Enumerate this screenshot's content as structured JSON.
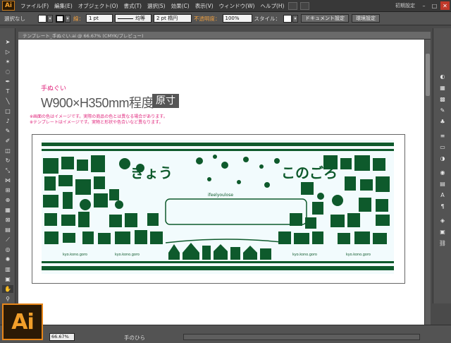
{
  "app": {
    "logo": "Ai"
  },
  "menu": [
    "ファイル(F)",
    "編集(E)",
    "オブジェクト(O)",
    "書式(T)",
    "選択(S)",
    "効果(C)",
    "表示(V)",
    "ウィンドウ(W)",
    "ヘルプ(H)"
  ],
  "workspace": "初期設定",
  "control": {
    "selection": "選択なし",
    "stroke_label": "線：",
    "stroke_weight": "1 pt",
    "stroke_style": "均等",
    "brush": "2 pt 楕円",
    "opacity_label": "不透明度：",
    "opacity": "100%",
    "style_label": "スタイル：",
    "doc_setup": "ドキュメント設定",
    "prefs": "環境設定"
  },
  "doc_tab": "テンプレート_手ぬぐい.ai @ 66.67% (CMYK/プレビュー)",
  "artboard": {
    "subtitle": "手ぬぐい",
    "size": "W900×H350mm程度",
    "badge": "原寸",
    "note1": "※画面の色はイメージです。実際の商品の色とは異なる場合があります。",
    "note2": "※テンプレートはイメージです。実物と形状や色合いなど異なります。"
  },
  "art_text": {
    "kyou": "きょう",
    "konogoro": "このごろ",
    "feel": "ifeelyoulose",
    "tag1": "kyo.kono.goro",
    "tag2": "kyo.kono.goro",
    "tag3": "kyo.kono.goro",
    "tag4": "kyo.kono.goro"
  },
  "status": {
    "zoom": "66.67%",
    "tool": "手のひら"
  },
  "colors": {
    "accent": "#e7861a",
    "art": "#0e5a2c",
    "pink": "#e0257c"
  }
}
